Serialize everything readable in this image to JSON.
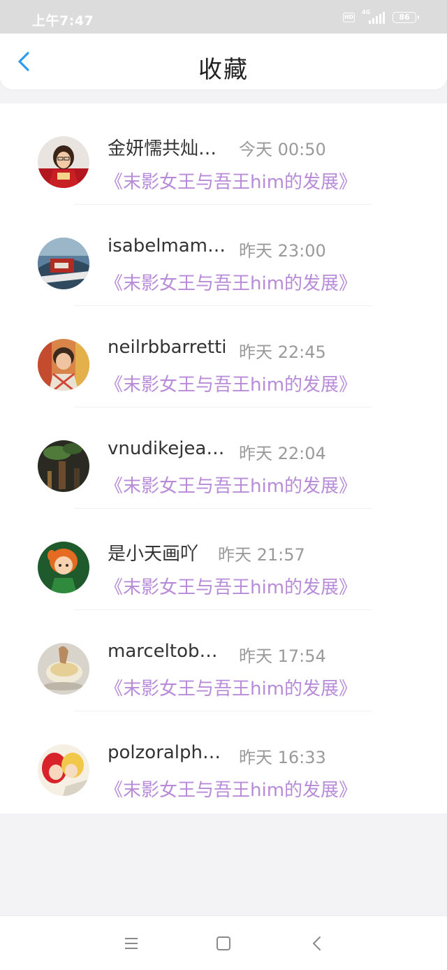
{
  "status_bar": {
    "time": "上午7:47",
    "hd": "HD",
    "network": "4G",
    "battery": "86"
  },
  "header": {
    "title": "收藏",
    "back_icon": "chevron-left-icon"
  },
  "favorites": [
    {
      "name": "金妍懦共灿…",
      "time": "今天 00:50",
      "post": "《末影女王与吾王him的发展》",
      "avatar": "avatar-red-shirt"
    },
    {
      "name": "isabelmam…",
      "time": "昨天 23:00",
      "post": "《末影女王与吾王him的发展》",
      "avatar": "avatar-boat"
    },
    {
      "name": "neilrbbarretti",
      "time": "昨天 22:45",
      "post": "《末影女王与吾王him的发展》",
      "avatar": "avatar-child"
    },
    {
      "name": "vnudikejea…",
      "time": "昨天 22:04",
      "post": "《末影女王与吾王him的发展》",
      "avatar": "avatar-dark-plant"
    },
    {
      "name": "是小天画吖",
      "time": "昨天 21:57",
      "post": "《末影女王与吾王him的发展》",
      "avatar": "avatar-cartoon-girl"
    },
    {
      "name": "marceltob…",
      "time": "昨天 17:54",
      "post": "《末影女王与吾王him的发展》",
      "avatar": "avatar-dessert"
    },
    {
      "name": "polzoralph…",
      "time": "昨天 16:33",
      "post": "《末影女王与吾王him的发展》",
      "avatar": "avatar-anime-kiss"
    }
  ],
  "nav_bar": {
    "menu_icon": "menu-icon",
    "home_icon": "home-square-icon",
    "back_icon": "back-triangle-icon"
  },
  "colors": {
    "accent": "#2f9bf0",
    "link": "#b78bd8",
    "status_bar": "#dcdcdc",
    "page_bg": "#f3f3f5"
  }
}
